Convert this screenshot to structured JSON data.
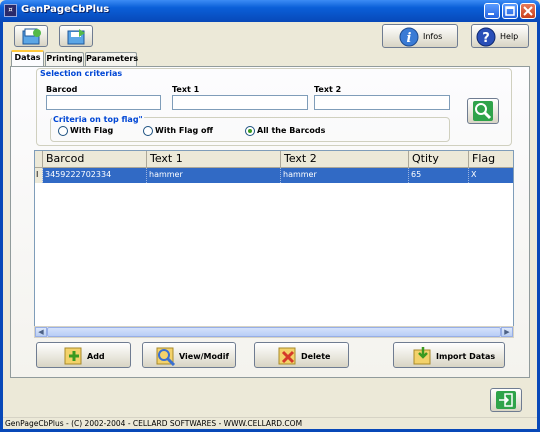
{
  "window": {
    "title": "GenPageCbPlus",
    "icon_text": "¤"
  },
  "toolbar": {
    "infos_label": "Infos",
    "help_label": "Help"
  },
  "tabs": [
    {
      "label": "Datas",
      "active": true
    },
    {
      "label": "Printing",
      "active": false
    },
    {
      "label": "Parameters",
      "active": false
    }
  ],
  "selection": {
    "title": "Selection criterias",
    "barcod_label": "Barcod",
    "text1_label": "Text 1",
    "text2_label": "Text 2",
    "barcod_value": "",
    "text1_value": "",
    "text2_value": "",
    "flag_title": "Criteria on top flag\"",
    "radio_with_flag": "With Flag",
    "radio_with_flag_off": "With Flag off",
    "radio_all": "All the Barcods",
    "selected": "All the Barcods"
  },
  "grid": {
    "columns": [
      "Barcod",
      "Text 1",
      "Text 2",
      "Qtity",
      "Flag"
    ],
    "rows": [
      {
        "marker": "I",
        "cells": [
          "3459222702334",
          "hammer",
          "hammer",
          "65",
          "X"
        ]
      }
    ]
  },
  "actions": {
    "add": "Add",
    "view_modif": "View/Modif",
    "delete": "Delete",
    "import": "Import Datas"
  },
  "status": {
    "text": "GenPageCbPlus - (C) 2002-2004 - CELLARD SOFTWARES - WWW.CELLARD.COM"
  },
  "colors": {
    "title_bar": "#0848b8",
    "group_title": "#0046d5",
    "selection": "#316ac5",
    "action_green": "#3b9a20"
  }
}
